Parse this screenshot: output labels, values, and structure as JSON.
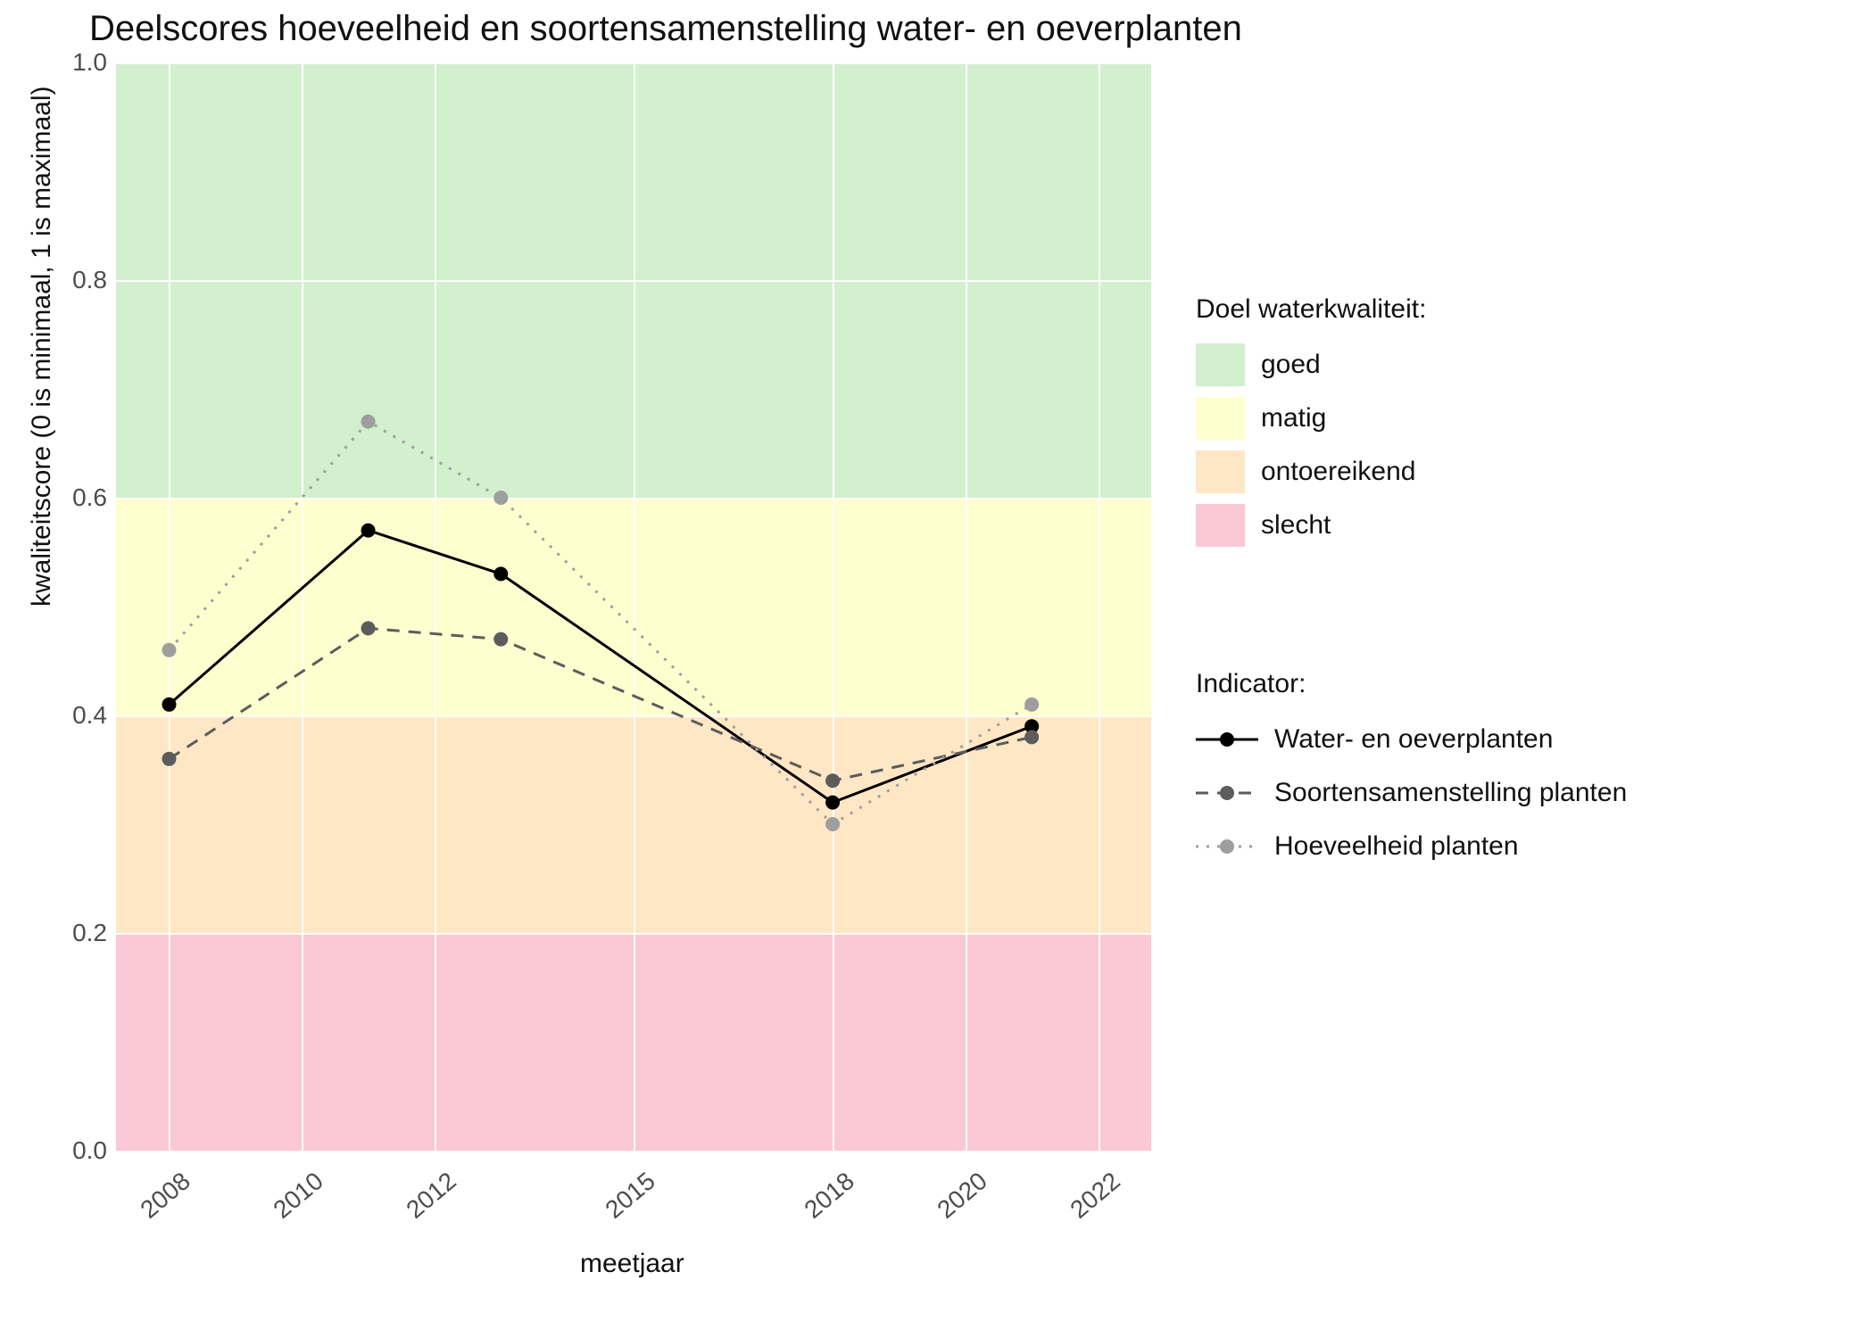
{
  "chart_data": {
    "type": "line",
    "title": "Deelscores hoeveelheid en soortensamenstelling water- en oeverplanten",
    "xlabel": "meetjaar",
    "ylabel": "kwaliteitscore (0 is minimaal, 1 is maximaal)",
    "x_ticks": [
      2008,
      2010,
      2012,
      2015,
      2018,
      2020,
      2022
    ],
    "y_ticks": [
      0.0,
      0.2,
      0.4,
      0.6,
      0.8,
      1.0
    ],
    "ylim": [
      0.0,
      1.0
    ],
    "bands": [
      {
        "name": "goed",
        "from": 0.6,
        "to": 1.0,
        "color": "#d2efce"
      },
      {
        "name": "matig",
        "from": 0.4,
        "to": 0.6,
        "color": "#feffcf"
      },
      {
        "name": "ontoereikend",
        "from": 0.2,
        "to": 0.4,
        "color": "#ffe7c5"
      },
      {
        "name": "slecht",
        "from": 0.0,
        "to": 0.2,
        "color": "#fac8d6"
      }
    ],
    "series": [
      {
        "name": "Water- en oeverplanten",
        "color": "#000000",
        "dash": "solid",
        "x": [
          2008,
          2011,
          2013,
          2018,
          2021
        ],
        "y": [
          0.41,
          0.57,
          0.53,
          0.32,
          0.39
        ]
      },
      {
        "name": "Soortensamenstelling planten",
        "color": "#5c5c5c",
        "dash": "dashed",
        "x": [
          2008,
          2011,
          2013,
          2018,
          2021
        ],
        "y": [
          0.36,
          0.48,
          0.47,
          0.34,
          0.38
        ]
      },
      {
        "name": "Hoeveelheid planten",
        "color": "#9e9e9e",
        "dash": "dotted",
        "x": [
          2008,
          2011,
          2013,
          2018,
          2021
        ],
        "y": [
          0.46,
          0.67,
          0.6,
          0.3,
          0.41
        ]
      }
    ],
    "legend_quality_title": "Doel waterkwaliteit:",
    "legend_indicator_title": "Indicator:"
  }
}
